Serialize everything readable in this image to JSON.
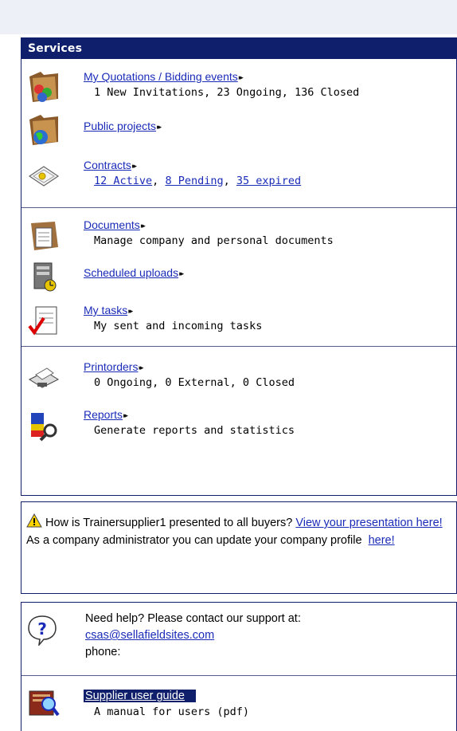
{
  "services": {
    "header": "Services",
    "items": [
      {
        "label": "My Quotations / Bidding events",
        "arrows": "▸▸",
        "desc": "1 New Invitations, 23 Ongoing, 136 Closed"
      },
      {
        "label": "Public projects",
        "arrows": "▸▸"
      },
      {
        "label": "Contracts",
        "arrows": "▸▸",
        "links": [
          "12 Active",
          "8 Pending",
          "35 expired"
        ],
        "sep": ","
      },
      {
        "label": "Documents",
        "arrows": "▸▸",
        "desc": "Manage company and personal documents"
      },
      {
        "label": "Scheduled uploads",
        "arrows": "▸▸"
      },
      {
        "label": "My tasks",
        "arrows": "▸▸",
        "desc": "My sent and incoming tasks"
      },
      {
        "label": "Printorders",
        "arrows": "▸▸",
        "desc": "0 Ongoing, 0 External, 0 Closed"
      },
      {
        "label": "Reports",
        "arrows": "▸▸",
        "desc": "Generate reports and statistics"
      }
    ]
  },
  "buyers_notice": {
    "text1": "How is Trainersupplier1  presented to all buyers?",
    "link1": "View your presentation here!",
    "text2": "As a company administrator you can update your company profile",
    "link2": "here!"
  },
  "help": {
    "line1": "Need help? Please contact our support at:",
    "email": "csas@sellafieldsites.com",
    "phone_label": "phone:",
    "guide_label": "Supplier user guide",
    "guide_desc": "A manual for users (pdf)"
  }
}
